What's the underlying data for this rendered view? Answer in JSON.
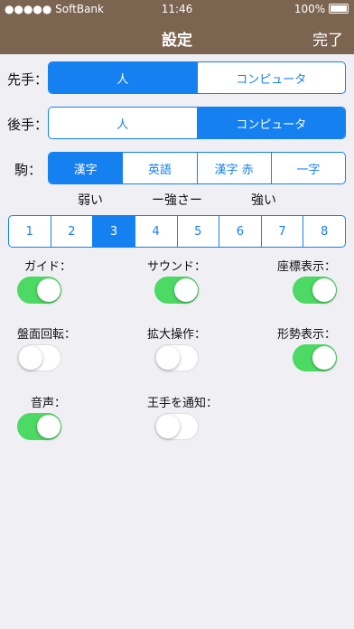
{
  "status": {
    "carrier": "●●●●● SoftBank",
    "time": "11:46",
    "battery": "100%"
  },
  "nav": {
    "title": "設定",
    "done": "完了"
  },
  "sente": {
    "label": "先手：",
    "options": [
      "人",
      "コンピュータ"
    ],
    "selected": 0
  },
  "gote": {
    "label": "後手：",
    "options": [
      "人",
      "コンピュータ"
    ],
    "selected": 1
  },
  "koma": {
    "label": "駒：",
    "options": [
      "漢字",
      "英語",
      "漢字 赤",
      "一字"
    ],
    "selected": 0
  },
  "strength": {
    "labels": [
      "弱い",
      "ー強さー",
      "強い"
    ],
    "levels": [
      "1",
      "2",
      "3",
      "4",
      "5",
      "6",
      "7",
      "8"
    ],
    "selected": 2
  },
  "toggles": [
    {
      "label": "ガイド：",
      "on": true
    },
    {
      "label": "サウンド：",
      "on": true
    },
    {
      "label": "座標表示：",
      "on": true
    },
    {
      "label": "盤面回転：",
      "on": false
    },
    {
      "label": "拡大操作：",
      "on": false
    },
    {
      "label": "形勢表示：",
      "on": true
    },
    {
      "label": "音声：",
      "on": true
    },
    {
      "label": "王手を通知：",
      "on": false
    }
  ],
  "colors": {
    "nav": "#7b6450",
    "accent": "#1580f0",
    "switch_on": "#4cd964",
    "background": "#efeff4"
  }
}
